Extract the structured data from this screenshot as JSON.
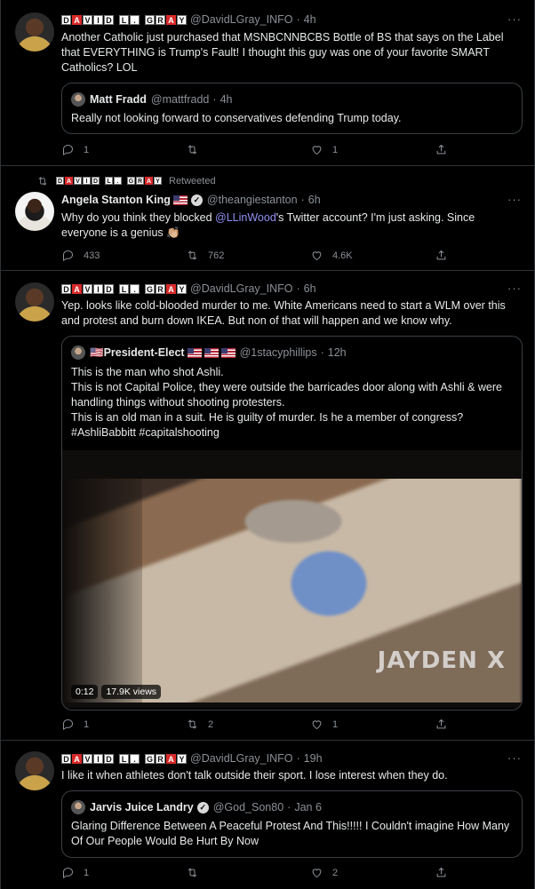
{
  "author_blocks": [
    {
      "letter": "D",
      "red": false
    },
    {
      "letter": "A",
      "red": true
    },
    {
      "letter": "V",
      "red": false
    },
    {
      "letter": "I",
      "red": false
    },
    {
      "letter": "D",
      "red": false
    },
    {
      "letter": " ",
      "gap": true
    },
    {
      "letter": "L",
      "red": false
    },
    {
      "letter": ".",
      "red": false
    },
    {
      "letter": " ",
      "gap": true
    },
    {
      "letter": "G",
      "red": false
    },
    {
      "letter": "R",
      "red": false
    },
    {
      "letter": "A",
      "red": true
    },
    {
      "letter": "Y",
      "red": false
    }
  ],
  "tweets": [
    {
      "handle": "@DavidLGray_INFO",
      "time": "4h",
      "text": "Another Catholic just purchased that MSNBCNNBCBS Bottle of BS that says on the Label that EVERYTHING is Trump's Fault! I thought this guy was one of your favorite SMART Catholics? LOL",
      "quote": {
        "name": "Matt Fradd",
        "handle": "@mattfradd",
        "time": "4h",
        "text": "Really not looking forward to conservatives defending Trump today."
      },
      "actions": {
        "reply": "1",
        "retweet": "",
        "like": "1"
      }
    },
    {
      "retweet_label": "Retweeted",
      "name": "Angela Stanton King",
      "handle": "@theangiestanton",
      "time": "6h",
      "text_before": "Why do you think they blocked ",
      "mention": "@LLinWood",
      "text_after": "'s Twitter account? I'm just asking. Since everyone is a genius 👏🏼",
      "actions": {
        "reply": "433",
        "retweet": "762",
        "like": "4.6K"
      }
    },
    {
      "handle": "@DavidLGray_INFO",
      "time": "6h",
      "text": "Yep. looks like cold-blooded murder to me. White Americans need to start a WLM over this and protest and burn down IKEA. But non of that will happen and we know why.",
      "quote": {
        "name": "🇺🇸President-Elect",
        "handle": "@1stacyphillips",
        "time": "12h",
        "lines": [
          "This is the man who shot Ashli.",
          "This is not Capital Police, they were outside the barricades door along with Ashli & were handling things without shooting protesters.",
          "This is an old man in a suit. He is guilty of murder. Is he a member of congress?",
          "#AshliBabbitt #capitalshooting"
        ],
        "video": {
          "watermark": "JAYDEN X",
          "duration": "0:12",
          "views": "17.9K views"
        }
      },
      "actions": {
        "reply": "1",
        "retweet": "2",
        "like": "1"
      }
    },
    {
      "handle": "@DavidLGray_INFO",
      "time": "19h",
      "text": "I like it when athletes don't talk outside their sport. I lose interest when they do.",
      "quote": {
        "name": "Jarvis Juice Landry",
        "handle": "@God_Son80",
        "time": "Jan 6",
        "text": "Glaring Difference Between A Peaceful Protest And This!!!!! I Couldn't imagine How Many Of Our People Would Be Hurt By Now"
      },
      "actions": {
        "reply": "1",
        "retweet": "",
        "like": "2"
      }
    }
  ],
  "separator": "·",
  "more_label": "···"
}
